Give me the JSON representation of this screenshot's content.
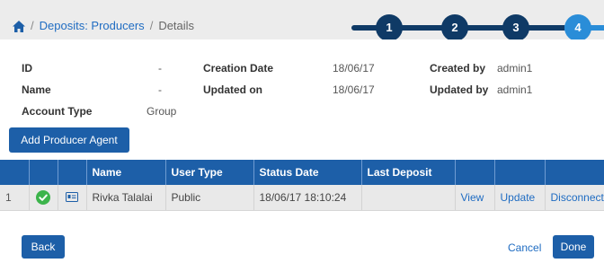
{
  "breadcrumb": {
    "items": [
      "Deposits: Producers",
      "Details"
    ],
    "separator": "/"
  },
  "stepper": {
    "steps": [
      "1",
      "2",
      "3",
      "4"
    ],
    "active_color": "#2a8dd8",
    "inactive_color": "#0f3a66"
  },
  "details": {
    "id_label": "ID",
    "id_value": "-",
    "name_label": "Name",
    "name_value": "-",
    "account_type_label": "Account Type",
    "account_type_value": "Group",
    "creation_date_label": "Creation Date",
    "creation_date_value": "18/06/17",
    "updated_on_label": "Updated on",
    "updated_on_value": "18/06/17",
    "created_by_label": "Created by",
    "created_by_value": "admin1",
    "updated_by_label": "Updated by",
    "updated_by_value": "admin1"
  },
  "add_button_label": "Add Producer Agent",
  "table": {
    "headers": [
      "",
      "",
      "",
      "Name",
      "User Type",
      "Status Date",
      "Last Deposit",
      "",
      "",
      ""
    ],
    "rows": [
      {
        "index": "1",
        "status_icon": "check-circle-icon",
        "type_icon": "id-card-icon",
        "name": "Rivka Talalai",
        "user_type": "Public",
        "status_date": "18/06/17 18:10:24",
        "last_deposit": "",
        "view": "View",
        "update": "Update",
        "disconnect": "Disconnect"
      }
    ]
  },
  "footer": {
    "back_label": "Back",
    "cancel_label": "Cancel",
    "done_label": "Done"
  },
  "colors": {
    "primary": "#1d5fa8",
    "link": "#1f6cc2",
    "success": "#3cb44b"
  }
}
